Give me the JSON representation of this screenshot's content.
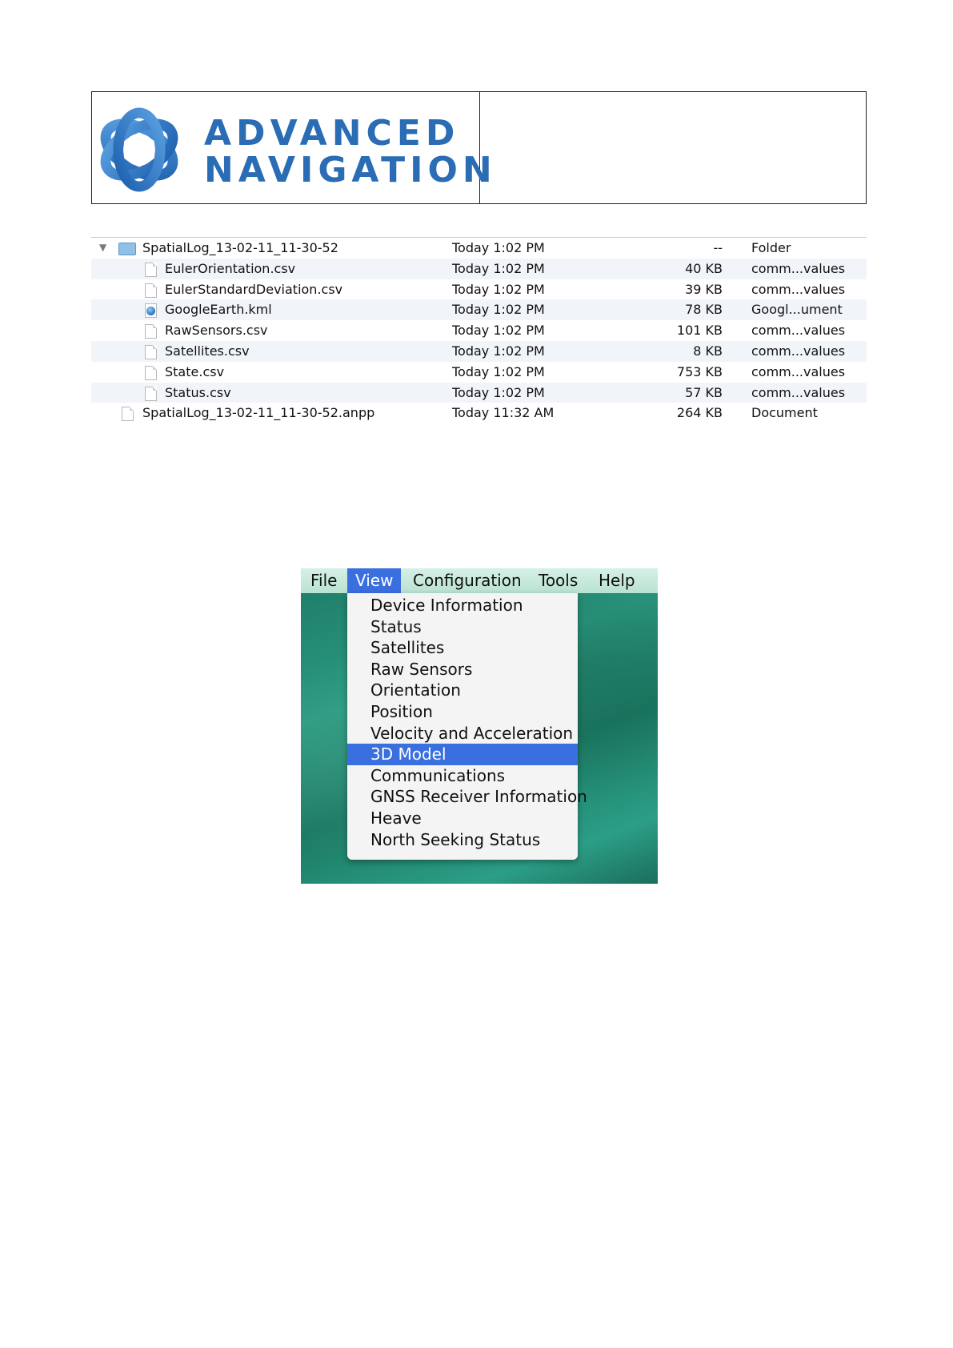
{
  "header": {
    "logo_line1": "ADVANCED",
    "logo_line2": "NAVIGATION",
    "brand_color": "#2a6db5"
  },
  "finder": {
    "rows": [
      {
        "name": "SpatialLog_13-02-11_11-30-52",
        "date": "Today 1:02 PM",
        "size": "--",
        "kind": "Folder",
        "icon": "folder-icon",
        "expanded": true
      },
      {
        "name": "EulerOrientation.csv",
        "date": "Today 1:02 PM",
        "size": "40 KB",
        "kind": "comm...values",
        "icon": "document-icon"
      },
      {
        "name": "EulerStandardDeviation.csv",
        "date": "Today 1:02 PM",
        "size": "39 KB",
        "kind": "comm...values",
        "icon": "document-icon"
      },
      {
        "name": "GoogleEarth.kml",
        "date": "Today 1:02 PM",
        "size": "78 KB",
        "kind": "Googl...ument",
        "icon": "kml-file-icon"
      },
      {
        "name": "RawSensors.csv",
        "date": "Today 1:02 PM",
        "size": "101 KB",
        "kind": "comm...values",
        "icon": "document-icon"
      },
      {
        "name": "Satellites.csv",
        "date": "Today 1:02 PM",
        "size": "8 KB",
        "kind": "comm...values",
        "icon": "document-icon"
      },
      {
        "name": "State.csv",
        "date": "Today 1:02 PM",
        "size": "753 KB",
        "kind": "comm...values",
        "icon": "document-icon"
      },
      {
        "name": "Status.csv",
        "date": "Today 1:02 PM",
        "size": "57 KB",
        "kind": "comm...values",
        "icon": "document-icon"
      },
      {
        "name": "SpatialLog_13-02-11_11-30-52.anpp",
        "date": "Today 11:32 AM",
        "size": "264 KB",
        "kind": "Document",
        "icon": "document-icon"
      }
    ]
  },
  "menu": {
    "bar_items": [
      "File",
      "View",
      "Configuration",
      "Tools",
      "Help"
    ],
    "active_bar_item": "View",
    "items": [
      "Device Information",
      "Status",
      "Satellites",
      "Raw Sensors",
      "Orientation",
      "Position",
      "Velocity and Acceleration",
      "3D Model",
      "Communications",
      "GNSS Receiver Information",
      "Heave",
      "North Seeking Status"
    ],
    "selected_item": "3D Model",
    "highlight_color": "#3a6fe0"
  }
}
